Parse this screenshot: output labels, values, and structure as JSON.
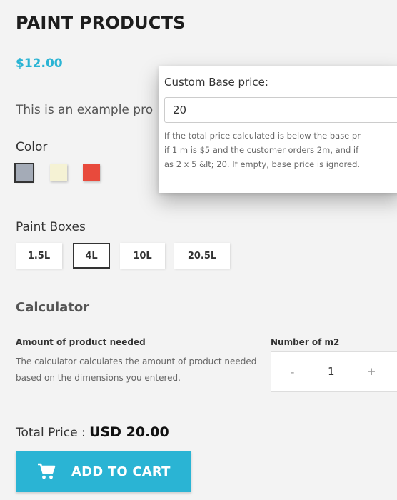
{
  "product": {
    "title": "PAINT PRODUCTS",
    "price": "$12.00",
    "description": "This is an example pro"
  },
  "color": {
    "label": "Color",
    "swatches": [
      {
        "name": "grey",
        "hex": "#a4abb7",
        "selected": true
      },
      {
        "name": "cream",
        "hex": "#f5f2d4",
        "selected": false
      },
      {
        "name": "red",
        "hex": "#e84a3c",
        "selected": false
      }
    ]
  },
  "paint_boxes": {
    "label": "Paint Boxes",
    "options": [
      "1.5L",
      "4L",
      "10L",
      "20.5L"
    ],
    "selected": "4L"
  },
  "calculator": {
    "title": "Calculator",
    "amount_title": "Amount of product needed",
    "amount_desc": "The calculator calculates the amount of product needed based on the dimensions you entered.",
    "m2_title": "Number of m2",
    "minus": "-",
    "value": "1",
    "plus": "+"
  },
  "total": {
    "label": "Total Price : ",
    "amount": "USD 20.00"
  },
  "cart": {
    "label": "ADD TO CART"
  },
  "popup": {
    "label": "Custom Base price:",
    "input_value": "20",
    "help_line1": "If the total price calculated is below the base pr",
    "help_line2": "if 1 m is $5 and the customer orders 2m, and if",
    "help_line3": "as 2 x 5 &lt; 20. If empty, base price is ignored."
  },
  "colors": {
    "accent": "#2ab4d4",
    "background": "#f3f3f3"
  }
}
